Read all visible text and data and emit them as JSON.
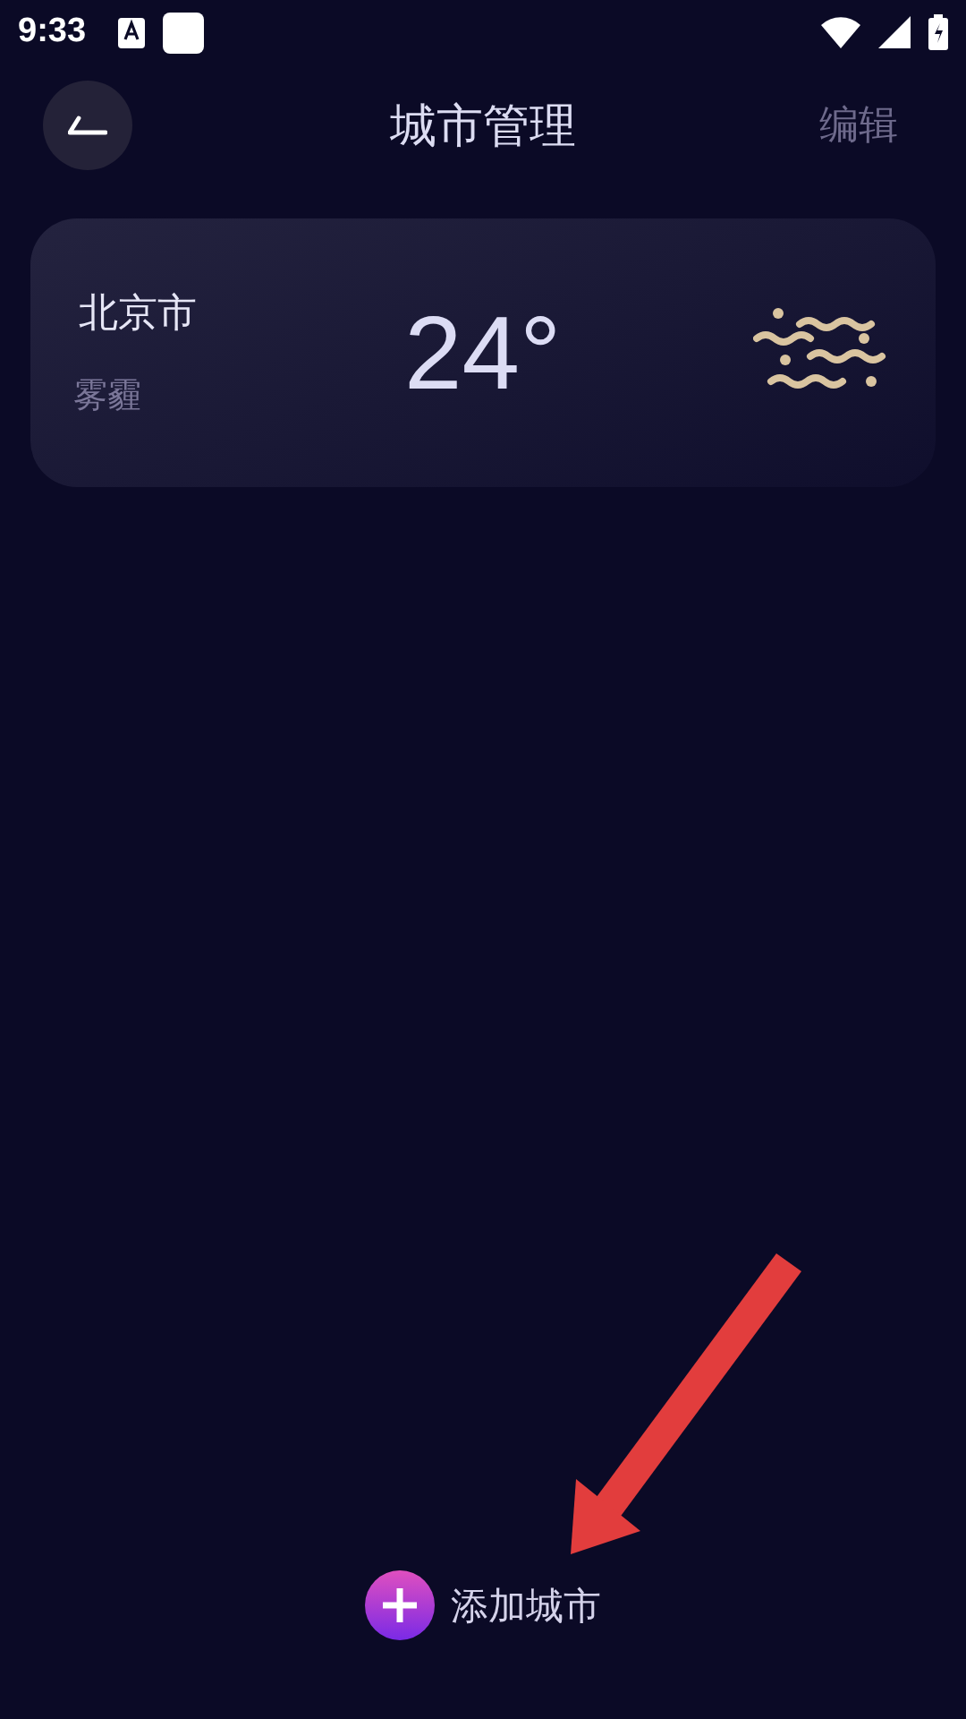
{
  "status_bar": {
    "time": "9:33"
  },
  "header": {
    "title": "城市管理",
    "action": "编辑"
  },
  "cities": [
    {
      "name": "北京市",
      "condition": "雾霾",
      "temperature": "24°"
    }
  ],
  "add_button": {
    "label": "添加城市"
  }
}
